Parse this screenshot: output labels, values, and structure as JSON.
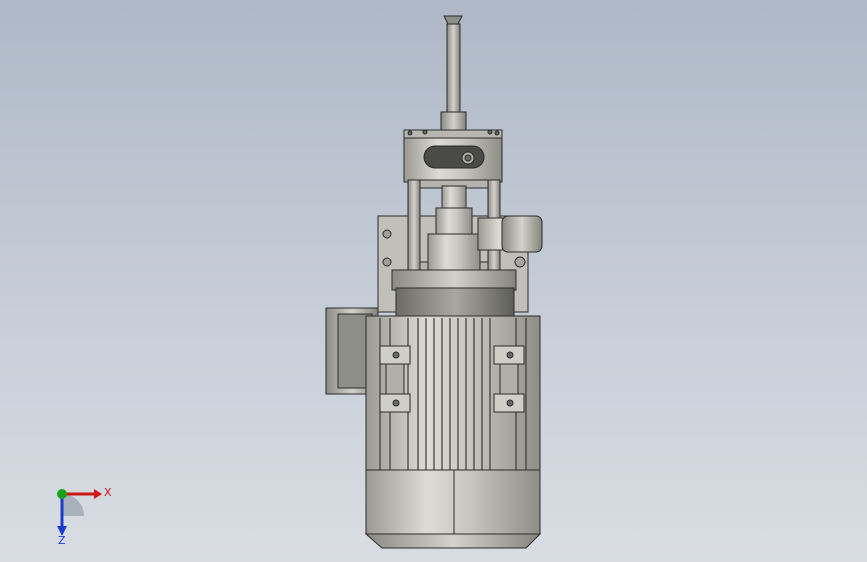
{
  "viewport": {
    "background_top": "#aeb8c6",
    "background_bottom": "#d9dde3"
  },
  "model": {
    "metal_color": "#c4c4bc",
    "edge_color": "#2a2a2a"
  },
  "triad": {
    "x_label": "X",
    "z_label": "Z",
    "x_color": "#d01818",
    "y_color": "#1aa01a",
    "z_color": "#1a3ad0"
  }
}
